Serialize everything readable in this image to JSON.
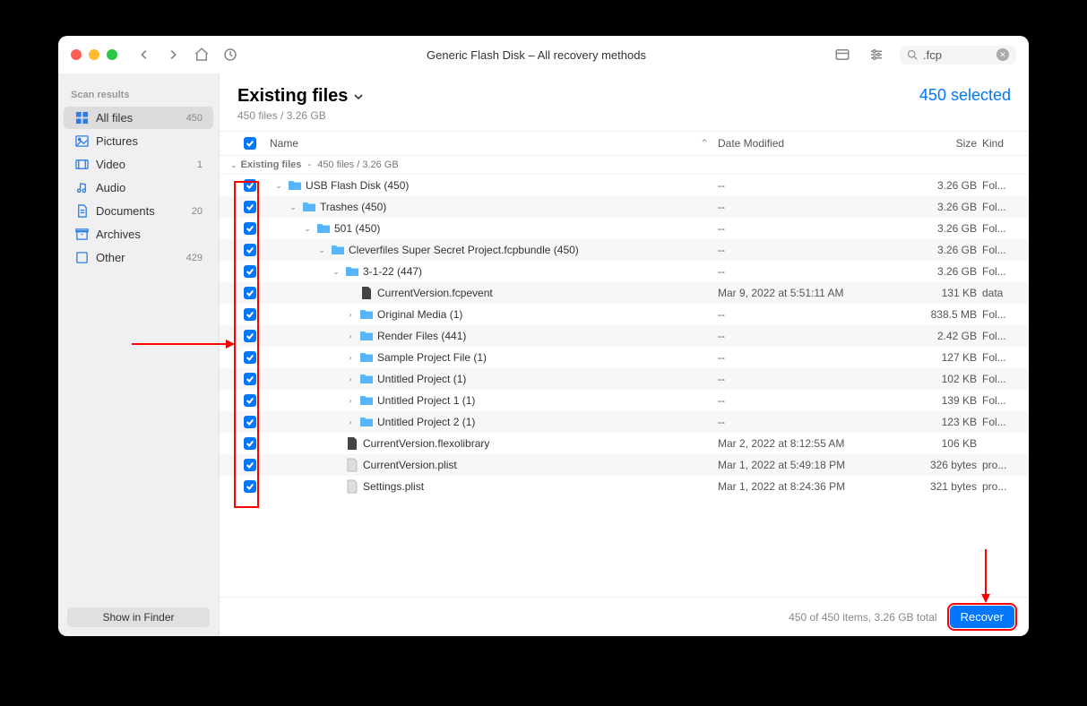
{
  "window": {
    "title": "Generic Flash Disk – All recovery methods",
    "search_value": ".fcp"
  },
  "sidebar": {
    "header": "Scan results",
    "items": [
      {
        "label": "All files",
        "badge": "450",
        "icon": "grid",
        "active": true
      },
      {
        "label": "Pictures",
        "badge": "",
        "icon": "picture"
      },
      {
        "label": "Video",
        "badge": "1",
        "icon": "video"
      },
      {
        "label": "Audio",
        "badge": "",
        "icon": "audio"
      },
      {
        "label": "Documents",
        "badge": "20",
        "icon": "doc"
      },
      {
        "label": "Archives",
        "badge": "",
        "icon": "archive"
      },
      {
        "label": "Other",
        "badge": "429",
        "icon": "other"
      }
    ],
    "footer_button": "Show in Finder"
  },
  "main": {
    "title": "Existing files",
    "subtitle": "450 files / 3.26 GB",
    "selection": "450 selected",
    "columns": {
      "name": "Name",
      "date": "Date Modified",
      "size": "Size",
      "kind": "Kind"
    },
    "breadcrumb_prefix": "Existing files",
    "breadcrumb_suffix": "450 files / 3.26 GB"
  },
  "rows": [
    {
      "indent": 0,
      "disclose": "down",
      "icon": "folder",
      "name": "USB Flash Disk (450)",
      "date": "--",
      "size": "3.26 GB",
      "kind": "Fol..."
    },
    {
      "indent": 1,
      "disclose": "down",
      "icon": "folder",
      "name": "Trashes (450)",
      "date": "--",
      "size": "3.26 GB",
      "kind": "Fol..."
    },
    {
      "indent": 2,
      "disclose": "down",
      "icon": "folder",
      "name": "501 (450)",
      "date": "--",
      "size": "3.26 GB",
      "kind": "Fol..."
    },
    {
      "indent": 3,
      "disclose": "down",
      "icon": "folder",
      "name": "Cleverfiles Super Secret Project.fcpbundle (450)",
      "date": "--",
      "size": "3.26 GB",
      "kind": "Fol..."
    },
    {
      "indent": 4,
      "disclose": "down",
      "icon": "folder",
      "name": "3-1-22 (447)",
      "date": "--",
      "size": "3.26 GB",
      "kind": "Fol..."
    },
    {
      "indent": 5,
      "disclose": "",
      "icon": "dark",
      "name": "CurrentVersion.fcpevent",
      "date": "Mar 9, 2022 at 5:51:11 AM",
      "size": "131 KB",
      "kind": "data"
    },
    {
      "indent": 5,
      "disclose": "right",
      "icon": "folder",
      "name": "Original Media (1)",
      "date": "--",
      "size": "838.5 MB",
      "kind": "Fol..."
    },
    {
      "indent": 5,
      "disclose": "right",
      "icon": "folder",
      "name": "Render Files (441)",
      "date": "--",
      "size": "2.42 GB",
      "kind": "Fol..."
    },
    {
      "indent": 5,
      "disclose": "right",
      "icon": "folder",
      "name": "Sample Project File (1)",
      "date": "--",
      "size": "127 KB",
      "kind": "Fol..."
    },
    {
      "indent": 5,
      "disclose": "right",
      "icon": "folder",
      "name": "Untitled Project (1)",
      "date": "--",
      "size": "102 KB",
      "kind": "Fol..."
    },
    {
      "indent": 5,
      "disclose": "right",
      "icon": "folder",
      "name": "Untitled Project 1 (1)",
      "date": "--",
      "size": "139 KB",
      "kind": "Fol..."
    },
    {
      "indent": 5,
      "disclose": "right",
      "icon": "folder",
      "name": "Untitled Project 2 (1)",
      "date": "--",
      "size": "123 KB",
      "kind": "Fol..."
    },
    {
      "indent": 4,
      "disclose": "",
      "icon": "dark",
      "name": "CurrentVersion.flexolibrary",
      "date": "Mar 2, 2022 at 8:12:55 AM",
      "size": "106 KB",
      "kind": ""
    },
    {
      "indent": 4,
      "disclose": "",
      "icon": "file",
      "name": "CurrentVersion.plist",
      "date": "Mar 1, 2022 at 5:49:18 PM",
      "size": "326 bytes",
      "kind": "pro..."
    },
    {
      "indent": 4,
      "disclose": "",
      "icon": "file",
      "name": "Settings.plist",
      "date": "Mar 1, 2022 at 8:24:36 PM",
      "size": "321 bytes",
      "kind": "pro..."
    }
  ],
  "footer": {
    "info": "450 of 450 items, 3.26 GB total",
    "button": "Recover"
  }
}
